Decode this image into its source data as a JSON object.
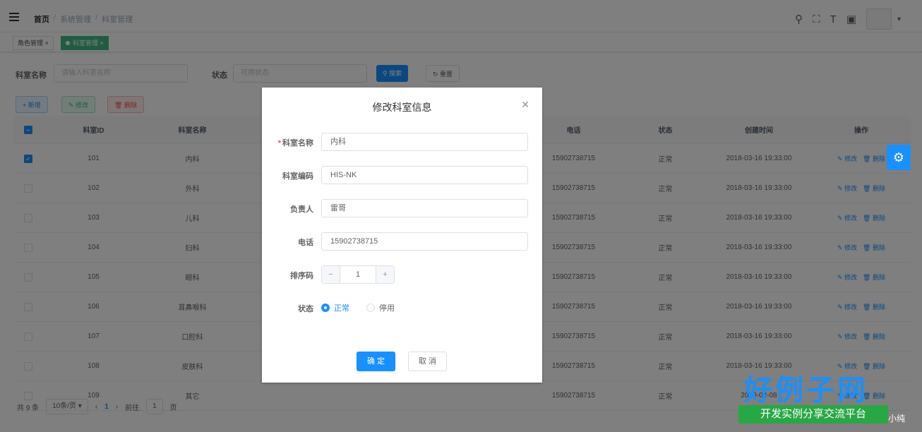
{
  "breadcrumb": [
    "首页",
    "系统管理",
    "科室管理"
  ],
  "tags": [
    {
      "label": "角色管理",
      "active": false
    },
    {
      "label": "科室管理",
      "active": true
    }
  ],
  "search": {
    "name_label": "科室名称",
    "name_placeholder": "请输入科室名称",
    "status_label": "状态",
    "status_placeholder": "可用状态",
    "search_btn": "搜索",
    "reset_btn": "重置"
  },
  "toolbar": {
    "add": "新增",
    "edit": "修改",
    "delete": "删除"
  },
  "table": {
    "columns": [
      "科室ID",
      "科室名称",
      "电话",
      "状态",
      "创建时间",
      "操作"
    ],
    "rows": [
      {
        "id": "101",
        "name": "内科",
        "phone": "15902738715",
        "status": "正常",
        "created": "2018-03-16 19:33:00",
        "checked": true
      },
      {
        "id": "102",
        "name": "外科",
        "phone": "15902738715",
        "status": "正常",
        "created": "2018-03-16 19:33:00",
        "checked": false
      },
      {
        "id": "103",
        "name": "儿科",
        "phone": "15902738715",
        "status": "正常",
        "created": "2018-03-16 19:33:00",
        "checked": false
      },
      {
        "id": "104",
        "name": "妇科",
        "phone": "15902738715",
        "status": "正常",
        "created": "2018-03-16 19:33:00",
        "checked": false
      },
      {
        "id": "105",
        "name": "眼科",
        "phone": "15902738715",
        "status": "正常",
        "created": "2018-03-16 19:33:00",
        "checked": false
      },
      {
        "id": "106",
        "name": "耳鼻喉科",
        "phone": "15902738715",
        "status": "正常",
        "created": "2018-03-16 19:33:00",
        "checked": false
      },
      {
        "id": "107",
        "name": "口腔科",
        "phone": "15902738715",
        "status": "正常",
        "created": "2018-03-16 19:33:00",
        "checked": false
      },
      {
        "id": "108",
        "name": "皮肤科",
        "phone": "15902738715",
        "status": "正常",
        "created": "2018-03-16 19:33:00",
        "checked": false
      },
      {
        "id": "109",
        "name": "其它",
        "phone": "15902738715",
        "status": "正常",
        "created": "2020-02-08",
        "checked": false
      }
    ],
    "action_edit": "修改",
    "action_delete": "删除"
  },
  "pager": {
    "total": "共 9 条",
    "size": "10条/页",
    "page": "1",
    "goto": "前往",
    "goto_val": "1",
    "unit": "页"
  },
  "dialog": {
    "title": "修改科室信息",
    "fields": {
      "name_label": "科室名称",
      "name_value": "内科",
      "code_label": "科室编码",
      "code_value": "HIS-NK",
      "leader_label": "负责人",
      "leader_value": "雷哥",
      "phone_label": "电话",
      "phone_value": "15902738715",
      "sort_label": "排序码",
      "sort_value": "1",
      "status_label": "状态",
      "status_on": "正常",
      "status_off": "停用"
    },
    "ok": "确 定",
    "cancel": "取 消"
  },
  "watermark": {
    "main": "好例子网",
    "sub": "开发实例分享交流平台",
    "tail": "小纯"
  },
  "colors": {
    "primary": "#1890ff",
    "success": "#13ce66",
    "danger": "#ff4949",
    "tag_active": "#42b983"
  }
}
